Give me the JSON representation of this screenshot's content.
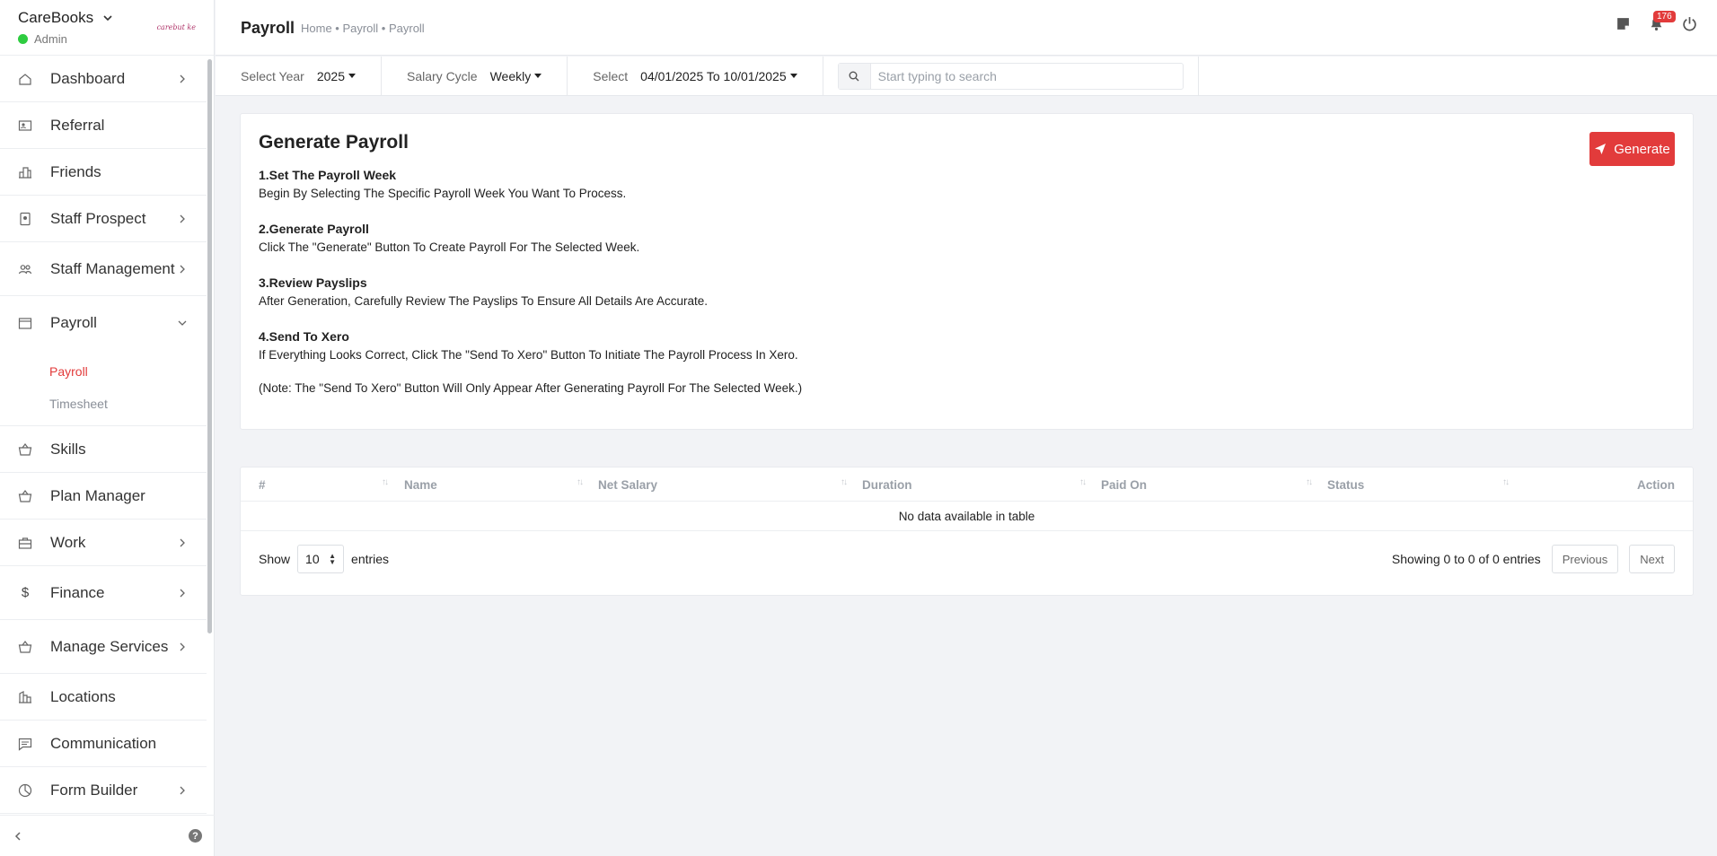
{
  "app": {
    "brand": "CareBooks",
    "role": "Admin",
    "logo_text": "carebut ke"
  },
  "sidebar": {
    "items": [
      {
        "label": "Dashboard",
        "icon": "home-icon",
        "has_chevron": true
      },
      {
        "label": "Referral",
        "icon": "id-card-icon",
        "has_chevron": false
      },
      {
        "label": "Friends",
        "icon": "building-icon",
        "has_chevron": false
      },
      {
        "label": "Staff Prospect",
        "icon": "badge-icon",
        "has_chevron": true
      },
      {
        "label": "Staff Management",
        "icon": "users-icon",
        "has_chevron": true
      },
      {
        "label": "Payroll",
        "icon": "calendar-icon",
        "has_chevron": true,
        "expanded": true
      },
      {
        "label": "Skills",
        "icon": "basket-icon",
        "has_chevron": false
      },
      {
        "label": "Plan Manager",
        "icon": "basket-icon",
        "has_chevron": false
      },
      {
        "label": "Work",
        "icon": "briefcase-icon",
        "has_chevron": true
      },
      {
        "label": "Finance",
        "icon": "dollar-icon",
        "has_chevron": true
      },
      {
        "label": "Manage Services",
        "icon": "basket-icon",
        "has_chevron": true
      },
      {
        "label": "Locations",
        "icon": "location-icon",
        "has_chevron": false
      },
      {
        "label": "Communication",
        "icon": "message-icon",
        "has_chevron": false
      },
      {
        "label": "Form Builder",
        "icon": "pie-chart-icon",
        "has_chevron": true
      }
    ],
    "payroll_sub": [
      {
        "label": "Payroll",
        "active": true
      },
      {
        "label": "Timesheet",
        "active": false
      }
    ]
  },
  "header": {
    "title": "Payroll",
    "breadcrumb": "Home • Payroll • Payroll",
    "notification_count": "176"
  },
  "filters": {
    "year_label": "Select Year",
    "year_value": "2025",
    "cycle_label": "Salary Cycle",
    "cycle_value": "Weekly",
    "range_label": "Select",
    "range_value": "04/01/2025 To 10/01/2025",
    "search_placeholder": "Start typing to search"
  },
  "instructions": {
    "title": "Generate Payroll",
    "generate_label": "Generate",
    "steps": [
      {
        "title": "1.Set The Payroll Week",
        "text": "Begin By Selecting The Specific Payroll Week You Want To Process."
      },
      {
        "title": "2.Generate Payroll",
        "text": "Click The \"Generate\" Button To Create Payroll For The Selected Week."
      },
      {
        "title": "3.Review Payslips",
        "text": "After Generation, Carefully Review The Payslips To Ensure All Details Are Accurate."
      },
      {
        "title": "4.Send To Xero",
        "text": "If Everything Looks Correct, Click The \"Send To Xero\" Button To Initiate The Payroll Process In Xero."
      }
    ],
    "note": "(Note: The \"Send To Xero\" Button Will Only Appear After Generating Payroll For The Selected Week.)"
  },
  "table": {
    "columns": [
      "#",
      "Name",
      "Net Salary",
      "Duration",
      "Paid On",
      "Status",
      "Action"
    ],
    "empty_text": "No data available in table",
    "show_label": "Show",
    "page_length": "10",
    "entries_label": "entries",
    "info": "Showing 0 to 0 of 0 entries",
    "prev_label": "Previous",
    "next_label": "Next"
  },
  "colors": {
    "accent": "#e23b3b",
    "online": "#2ecc40"
  }
}
